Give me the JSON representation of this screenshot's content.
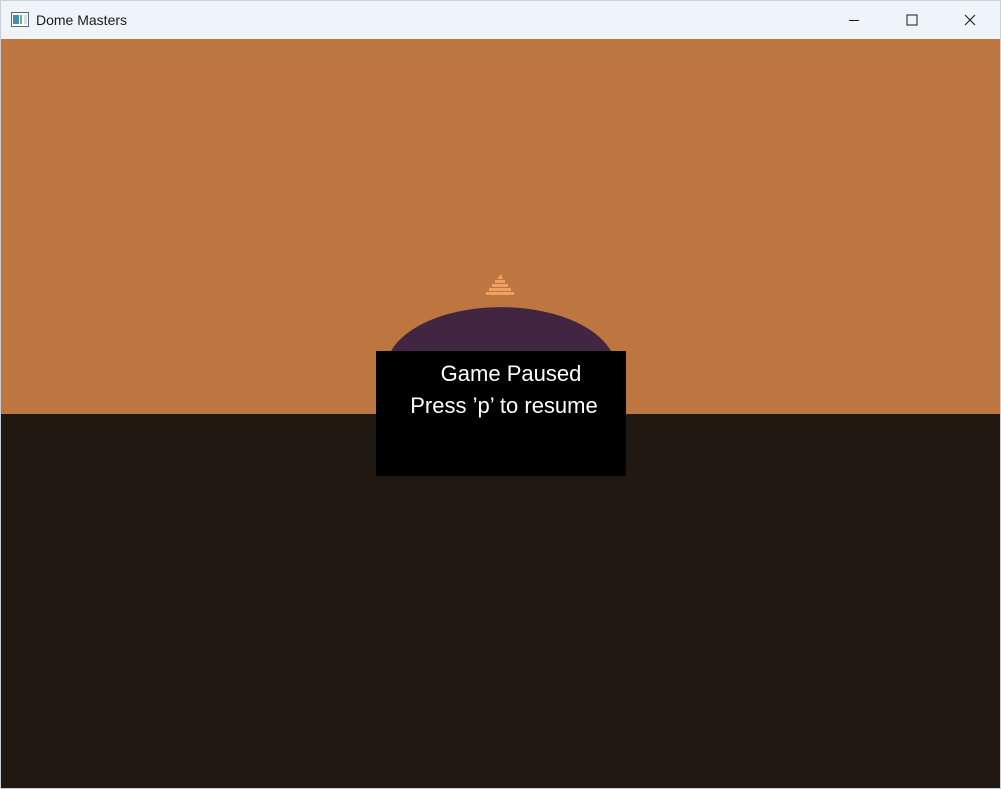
{
  "window": {
    "title": "Dome Masters",
    "icon": "app-window-icon",
    "controls": {
      "minimize_icon": "minimize-icon",
      "maximize_icon": "maximize-icon",
      "close_icon": "close-icon"
    }
  },
  "game": {
    "colors": {
      "sky": "#be7640",
      "ground": "#211811",
      "dome": "#412541",
      "turret": "#f0a060",
      "panel": "#000000",
      "text": "#ffffff"
    },
    "pause_overlay": {
      "title": "Game Paused",
      "hint": "Press ’p’ to resume"
    }
  }
}
